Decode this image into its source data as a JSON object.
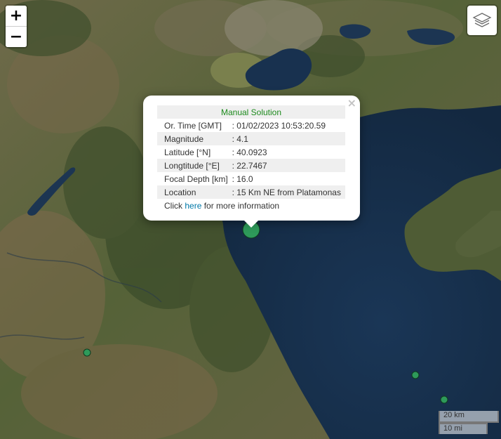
{
  "controls": {
    "zoom_in_label": "+",
    "zoom_out_label": "−"
  },
  "popup": {
    "close_label": "×",
    "title": "Manual Solution",
    "rows": [
      {
        "label": "Or. Time [GMT]",
        "value": ": 01/02/2023 10:53:20.59"
      },
      {
        "label": "Magnitude",
        "value": ": 4.1"
      },
      {
        "label": "Latitude [°N]",
        "value": ": 40.0923"
      },
      {
        "label": "Longtitude [°E]",
        "value": ": 22.7467"
      },
      {
        "label": "Focal Depth [km]",
        "value": ": 16.0"
      },
      {
        "label": "Location",
        "value": ": 15 Km NE from Platamonas"
      }
    ],
    "footer_prefix": "Click ",
    "footer_link": "here",
    "footer_suffix": " for more information"
  },
  "scale": {
    "metric_label": "20 km",
    "imperial_label": "10 mi"
  },
  "colors": {
    "sea": "#173050",
    "land": "#5b6840",
    "marker": "#2e9a5a",
    "popup_title": "#1d8a1d",
    "link": "#0078a8"
  }
}
